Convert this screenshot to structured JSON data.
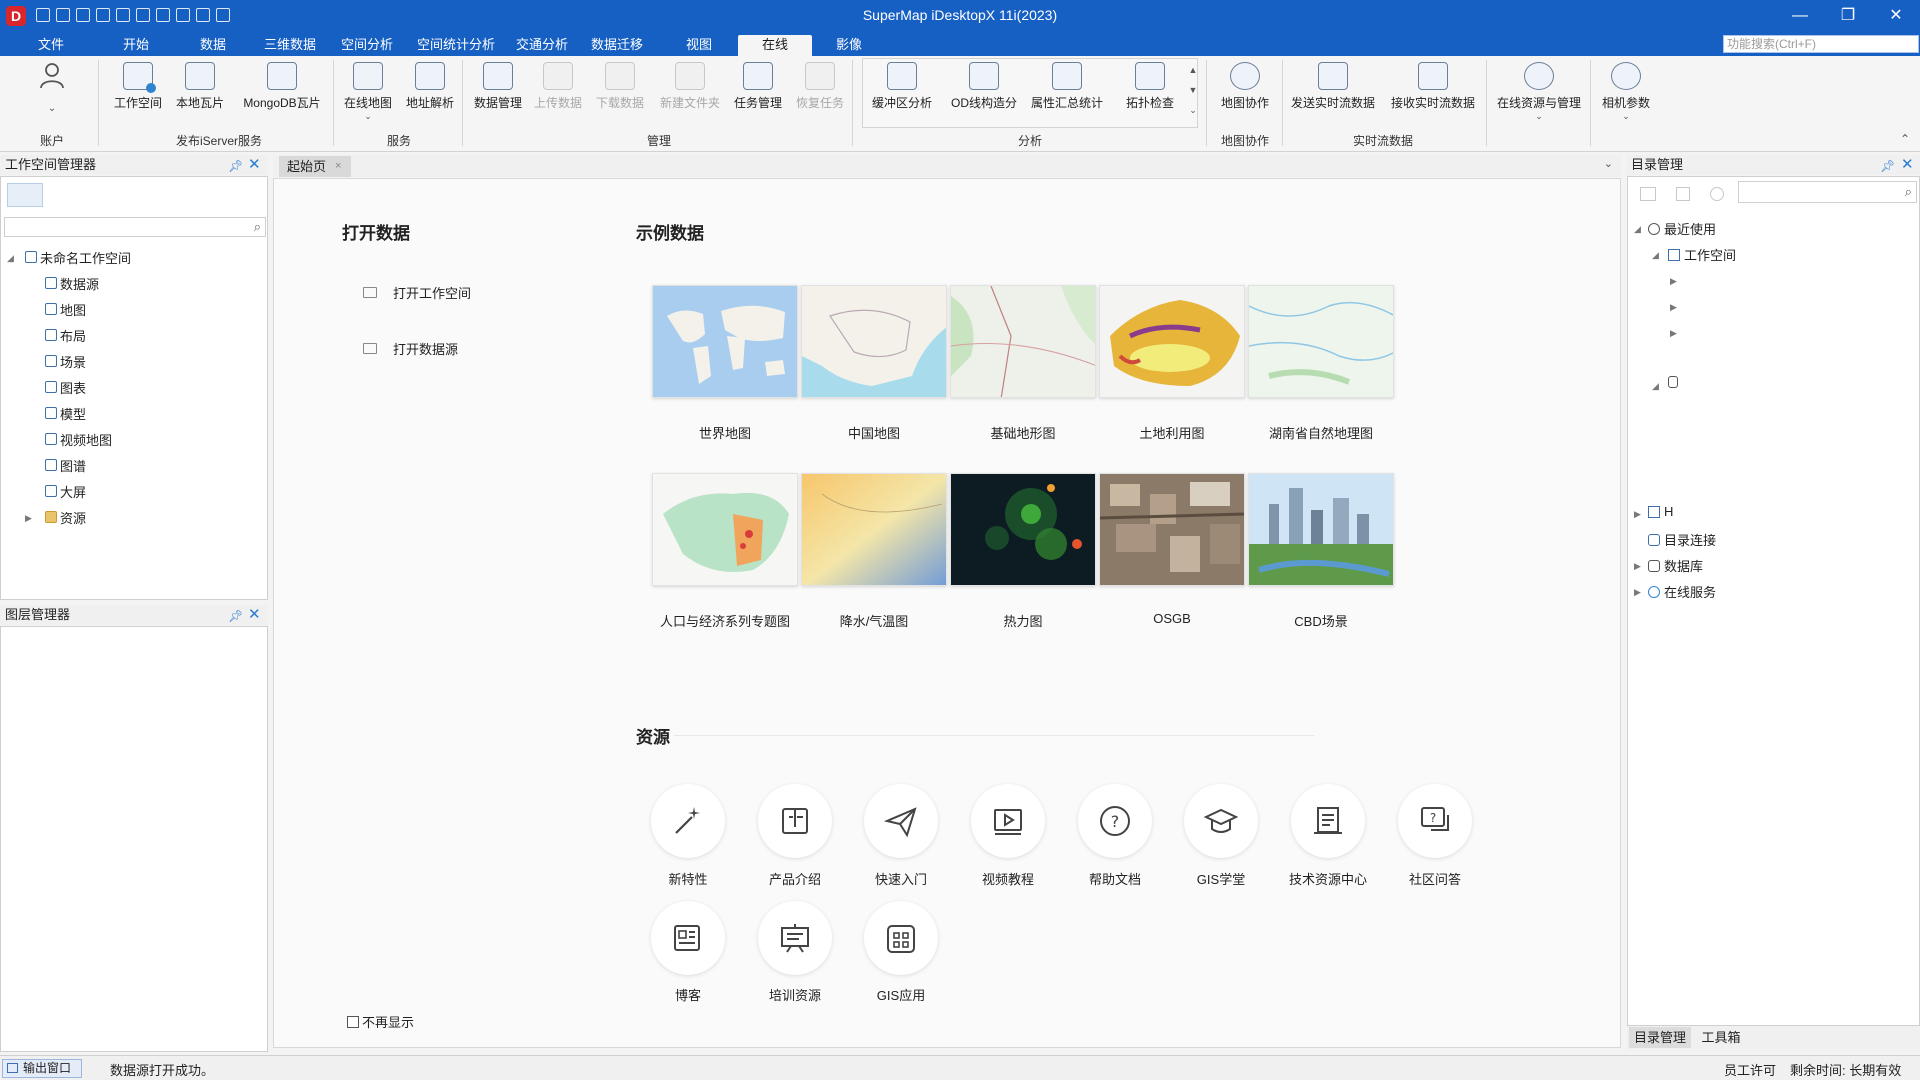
{
  "app": {
    "title": "SuperMap iDesktopX 11i(2023)",
    "logo_letter": "D"
  },
  "menu": {
    "tabs": [
      "文件",
      "开始",
      "数据",
      "三维数据",
      "空间分析",
      "空间统计分析",
      "交通分析",
      "数据迁移",
      "视图",
      "在线",
      "影像"
    ],
    "active": "在线",
    "search_placeholder": "功能搜索(Ctrl+F)"
  },
  "ribbon": {
    "account": "账户",
    "groups": {
      "publish": "发布iServer服务",
      "service": "服务",
      "manage": "管理",
      "analysis": "分析",
      "collab": "地图协作",
      "stream": "实时流数据"
    },
    "buttons": {
      "workspace": "工作空间",
      "local_tile": "本地瓦片",
      "mongodb_tile": "MongoDB瓦片",
      "online_map": "在线地图",
      "geocode": "地址解析",
      "data_manage": "数据管理",
      "upload": "上传数据",
      "download": "下载数据",
      "new_folder": "新建文件夹",
      "task_manage": "任务管理",
      "restore_task": "恢复任务",
      "buffer": "缓冲区分析",
      "od_line": "OD线构造分",
      "attr_stat": "属性汇总统计",
      "topo_check": "拓扑检查",
      "map_collab": "地图协作",
      "send_stream": "发送实时流数据",
      "recv_stream": "接收实时流数据",
      "online_res": "在线资源与管理",
      "camera": "相机参数"
    }
  },
  "workspace_panel": {
    "title": "工作空间管理器",
    "root": "未命名工作空间",
    "items": [
      "数据源",
      "地图",
      "布局",
      "场景",
      "图表",
      "模型",
      "视频地图",
      "图谱",
      "大屏",
      "资源"
    ]
  },
  "layer_panel": {
    "title": "图层管理器"
  },
  "doc_tab": {
    "label": "起始页",
    "close": "×"
  },
  "start": {
    "open_title": "打开数据",
    "open_workspace": "打开工作空间",
    "open_datasource": "打开数据源",
    "sample_title": "示例数据",
    "samples": [
      "世界地图",
      "中国地图",
      "基础地形图",
      "土地利用图",
      "湖南省自然地理图",
      "人口与经济系列专题图",
      "降水/气温图",
      "热力图",
      "OSGB",
      "CBD场景"
    ],
    "resource_title": "资源",
    "resources": [
      "新特性",
      "产品介绍",
      "快速入门",
      "视频教程",
      "帮助文档",
      "GIS学堂",
      "技术资源中心",
      "社区问答",
      "博客",
      "培训资源",
      "GIS应用"
    ],
    "dont_show": "不再显示"
  },
  "catalog": {
    "title": "目录管理",
    "recent": "最近使用",
    "workspace": "工作空间",
    "home": "H",
    "dir_conn": "目录连接",
    "database": "数据库",
    "online": "在线服务",
    "tab_catalog": "目录管理",
    "tab_toolbox": "工具箱"
  },
  "status": {
    "output_window": "输出窗口",
    "message": "数据源打开成功。",
    "license": "员工许可",
    "remaining": "剩余时间: 长期有效"
  },
  "colors": {
    "brand": "#1660c4"
  }
}
